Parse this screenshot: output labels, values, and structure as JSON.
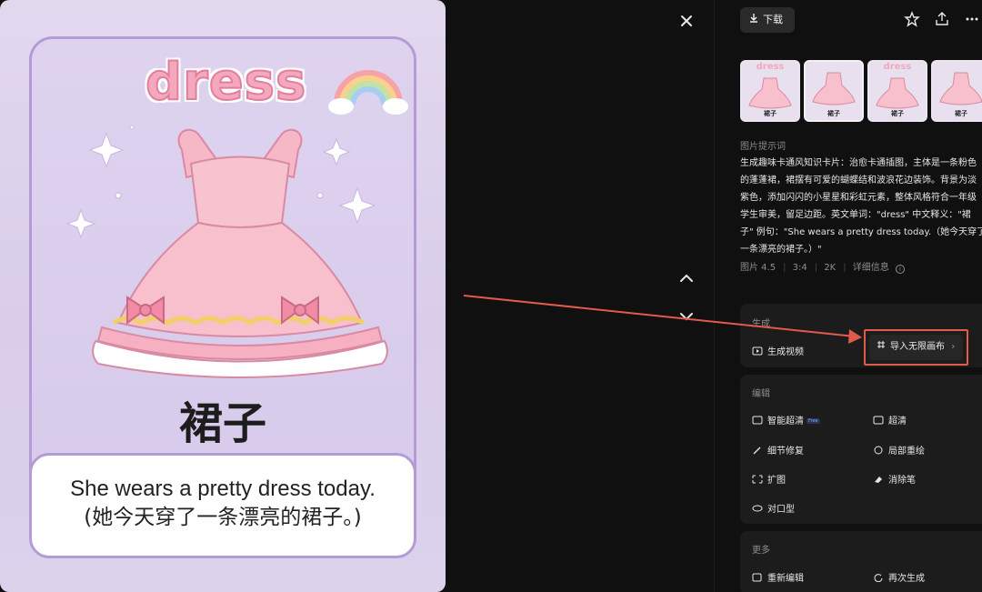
{
  "image": {
    "word_en": "dress",
    "word_cn": "裙子",
    "sentence_en": "She wears a pretty dress today.",
    "sentence_cn": "(她今天穿了一条漂亮的裙子。)"
  },
  "viewer": {
    "close_icon": "close-icon",
    "prev_icon": "chevron-up-icon",
    "next_icon": "chevron-down-icon"
  },
  "toolbar": {
    "download_label": "下载",
    "icons": [
      "star-icon",
      "share-icon",
      "more-icon"
    ]
  },
  "thumbnails": [
    {
      "word": "dress",
      "cn": "裙子"
    },
    {
      "word": "",
      "cn": "裙子"
    },
    {
      "word": "dress",
      "cn": "裙子"
    },
    {
      "word": "",
      "cn": "裙子"
    }
  ],
  "prompt": {
    "label": "图片提示词",
    "lines": [
      "生成趣味卡通风知识卡片：治愈卡通插图，主体是一条粉色",
      "的蓬蓬裙，裙摆有可爱的蝴蝶结和波浪花边装饰。背景为淡",
      "紫色，添加闪闪的小星星和彩虹元素，整体风格符合一年级",
      "学生审美，留足边距。英文单词：\"dress\" 中文释义：\"裙",
      "子\" 例句：\"She wears a pretty dress today.（她今天穿了",
      "一条漂亮的裙子。）\""
    ]
  },
  "meta": {
    "model": "图片 4.5",
    "ratio": "3:4",
    "resolution": "2K",
    "details_label": "详细信息"
  },
  "generate": {
    "title": "生成",
    "video_label": "生成视频",
    "import_label": "导入无限画布"
  },
  "edit": {
    "title": "编辑",
    "smart_hd": "智能超清",
    "badge": "Free",
    "hd": "超清",
    "detail_fix": "细节修复",
    "partial_redraw": "局部重绘",
    "expand": "扩图",
    "eraser": "消除笔",
    "lip_sync": "对口型"
  },
  "more": {
    "title": "更多",
    "re_edit": "重新编辑",
    "regenerate": "再次生成"
  },
  "colors": {
    "annotation": "#e25a4c",
    "background": "#101010",
    "card_lilac": "#d9cdea",
    "pink": "#f3a8bd"
  }
}
